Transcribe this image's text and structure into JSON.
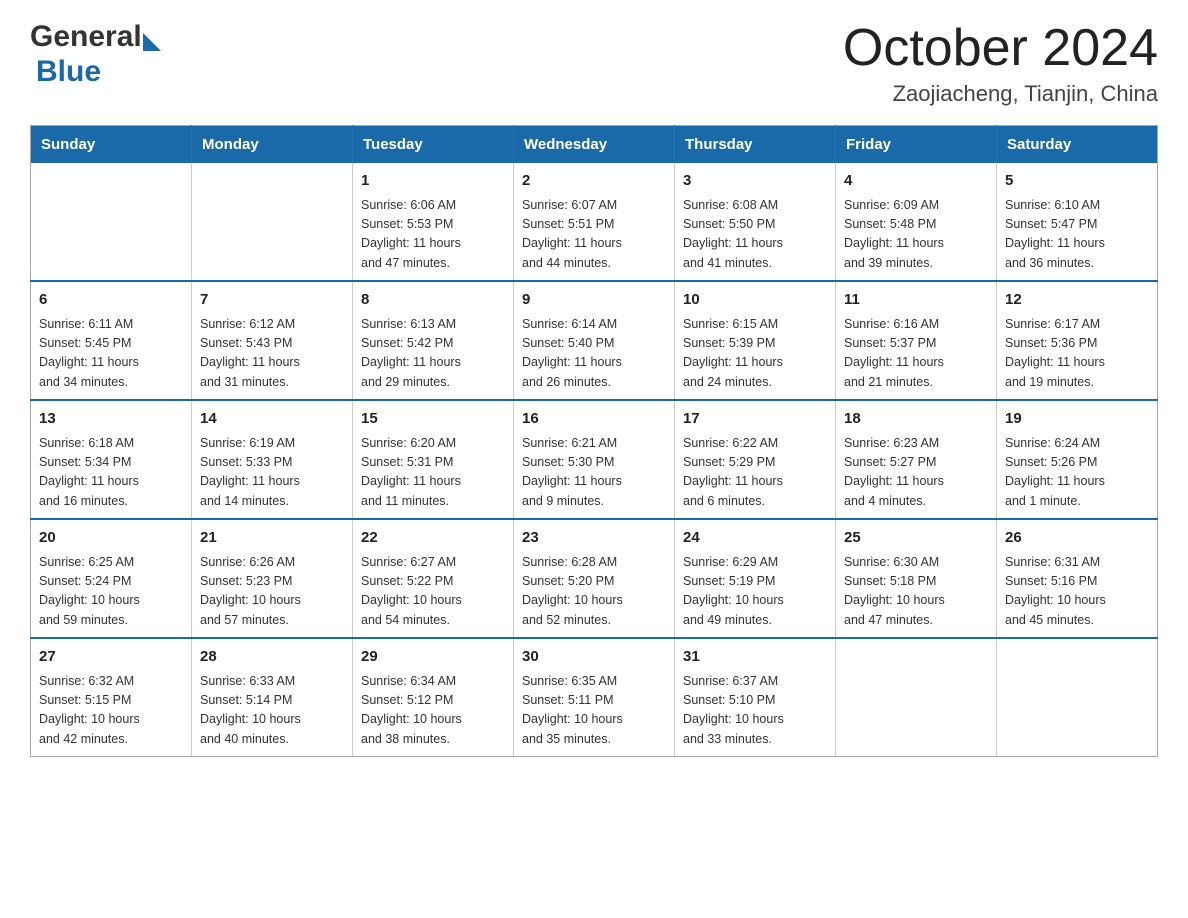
{
  "header": {
    "logo_general": "General",
    "logo_blue": "Blue",
    "month_title": "October 2024",
    "location": "Zaojiacheng, Tianjin, China"
  },
  "weekdays": [
    "Sunday",
    "Monday",
    "Tuesday",
    "Wednesday",
    "Thursday",
    "Friday",
    "Saturday"
  ],
  "weeks": [
    [
      {
        "day": "",
        "info": ""
      },
      {
        "day": "",
        "info": ""
      },
      {
        "day": "1",
        "info": "Sunrise: 6:06 AM\nSunset: 5:53 PM\nDaylight: 11 hours\nand 47 minutes."
      },
      {
        "day": "2",
        "info": "Sunrise: 6:07 AM\nSunset: 5:51 PM\nDaylight: 11 hours\nand 44 minutes."
      },
      {
        "day": "3",
        "info": "Sunrise: 6:08 AM\nSunset: 5:50 PM\nDaylight: 11 hours\nand 41 minutes."
      },
      {
        "day": "4",
        "info": "Sunrise: 6:09 AM\nSunset: 5:48 PM\nDaylight: 11 hours\nand 39 minutes."
      },
      {
        "day": "5",
        "info": "Sunrise: 6:10 AM\nSunset: 5:47 PM\nDaylight: 11 hours\nand 36 minutes."
      }
    ],
    [
      {
        "day": "6",
        "info": "Sunrise: 6:11 AM\nSunset: 5:45 PM\nDaylight: 11 hours\nand 34 minutes."
      },
      {
        "day": "7",
        "info": "Sunrise: 6:12 AM\nSunset: 5:43 PM\nDaylight: 11 hours\nand 31 minutes."
      },
      {
        "day": "8",
        "info": "Sunrise: 6:13 AM\nSunset: 5:42 PM\nDaylight: 11 hours\nand 29 minutes."
      },
      {
        "day": "9",
        "info": "Sunrise: 6:14 AM\nSunset: 5:40 PM\nDaylight: 11 hours\nand 26 minutes."
      },
      {
        "day": "10",
        "info": "Sunrise: 6:15 AM\nSunset: 5:39 PM\nDaylight: 11 hours\nand 24 minutes."
      },
      {
        "day": "11",
        "info": "Sunrise: 6:16 AM\nSunset: 5:37 PM\nDaylight: 11 hours\nand 21 minutes."
      },
      {
        "day": "12",
        "info": "Sunrise: 6:17 AM\nSunset: 5:36 PM\nDaylight: 11 hours\nand 19 minutes."
      }
    ],
    [
      {
        "day": "13",
        "info": "Sunrise: 6:18 AM\nSunset: 5:34 PM\nDaylight: 11 hours\nand 16 minutes."
      },
      {
        "day": "14",
        "info": "Sunrise: 6:19 AM\nSunset: 5:33 PM\nDaylight: 11 hours\nand 14 minutes."
      },
      {
        "day": "15",
        "info": "Sunrise: 6:20 AM\nSunset: 5:31 PM\nDaylight: 11 hours\nand 11 minutes."
      },
      {
        "day": "16",
        "info": "Sunrise: 6:21 AM\nSunset: 5:30 PM\nDaylight: 11 hours\nand 9 minutes."
      },
      {
        "day": "17",
        "info": "Sunrise: 6:22 AM\nSunset: 5:29 PM\nDaylight: 11 hours\nand 6 minutes."
      },
      {
        "day": "18",
        "info": "Sunrise: 6:23 AM\nSunset: 5:27 PM\nDaylight: 11 hours\nand 4 minutes."
      },
      {
        "day": "19",
        "info": "Sunrise: 6:24 AM\nSunset: 5:26 PM\nDaylight: 11 hours\nand 1 minute."
      }
    ],
    [
      {
        "day": "20",
        "info": "Sunrise: 6:25 AM\nSunset: 5:24 PM\nDaylight: 10 hours\nand 59 minutes."
      },
      {
        "day": "21",
        "info": "Sunrise: 6:26 AM\nSunset: 5:23 PM\nDaylight: 10 hours\nand 57 minutes."
      },
      {
        "day": "22",
        "info": "Sunrise: 6:27 AM\nSunset: 5:22 PM\nDaylight: 10 hours\nand 54 minutes."
      },
      {
        "day": "23",
        "info": "Sunrise: 6:28 AM\nSunset: 5:20 PM\nDaylight: 10 hours\nand 52 minutes."
      },
      {
        "day": "24",
        "info": "Sunrise: 6:29 AM\nSunset: 5:19 PM\nDaylight: 10 hours\nand 49 minutes."
      },
      {
        "day": "25",
        "info": "Sunrise: 6:30 AM\nSunset: 5:18 PM\nDaylight: 10 hours\nand 47 minutes."
      },
      {
        "day": "26",
        "info": "Sunrise: 6:31 AM\nSunset: 5:16 PM\nDaylight: 10 hours\nand 45 minutes."
      }
    ],
    [
      {
        "day": "27",
        "info": "Sunrise: 6:32 AM\nSunset: 5:15 PM\nDaylight: 10 hours\nand 42 minutes."
      },
      {
        "day": "28",
        "info": "Sunrise: 6:33 AM\nSunset: 5:14 PM\nDaylight: 10 hours\nand 40 minutes."
      },
      {
        "day": "29",
        "info": "Sunrise: 6:34 AM\nSunset: 5:12 PM\nDaylight: 10 hours\nand 38 minutes."
      },
      {
        "day": "30",
        "info": "Sunrise: 6:35 AM\nSunset: 5:11 PM\nDaylight: 10 hours\nand 35 minutes."
      },
      {
        "day": "31",
        "info": "Sunrise: 6:37 AM\nSunset: 5:10 PM\nDaylight: 10 hours\nand 33 minutes."
      },
      {
        "day": "",
        "info": ""
      },
      {
        "day": "",
        "info": ""
      }
    ]
  ]
}
